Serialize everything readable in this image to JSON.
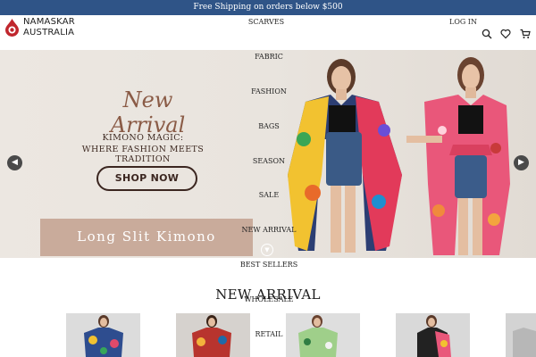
{
  "announcement": "Free Shipping on orders below $500",
  "brand": {
    "line1": "NAMASKAR",
    "line2": "AUSTRALIA"
  },
  "header": {
    "login_label": "LOG IN"
  },
  "nav": [
    "SCARVES",
    "FABRIC",
    "FASHION",
    "BAGS",
    "SEASON",
    "SALE",
    "NEW ARRIVAL",
    "BEST SELLERS",
    "WHOLESALE",
    "RETAIL"
  ],
  "hero": {
    "script_title": "New Arrival",
    "subtitle_line1": "KIMONO MAGIC:",
    "subtitle_line2": "WHERE FASHION MEETS TRADITION",
    "button_label": "SHOP NOW",
    "caption": "Long Slit Kimono"
  },
  "section": {
    "title": "NEW ARRIVAL"
  },
  "colors": {
    "topbar": "#2f5487",
    "brand_accent": "#c0262d",
    "caption_bg": "#c9ab9b",
    "button_outline": "#3b2620"
  }
}
